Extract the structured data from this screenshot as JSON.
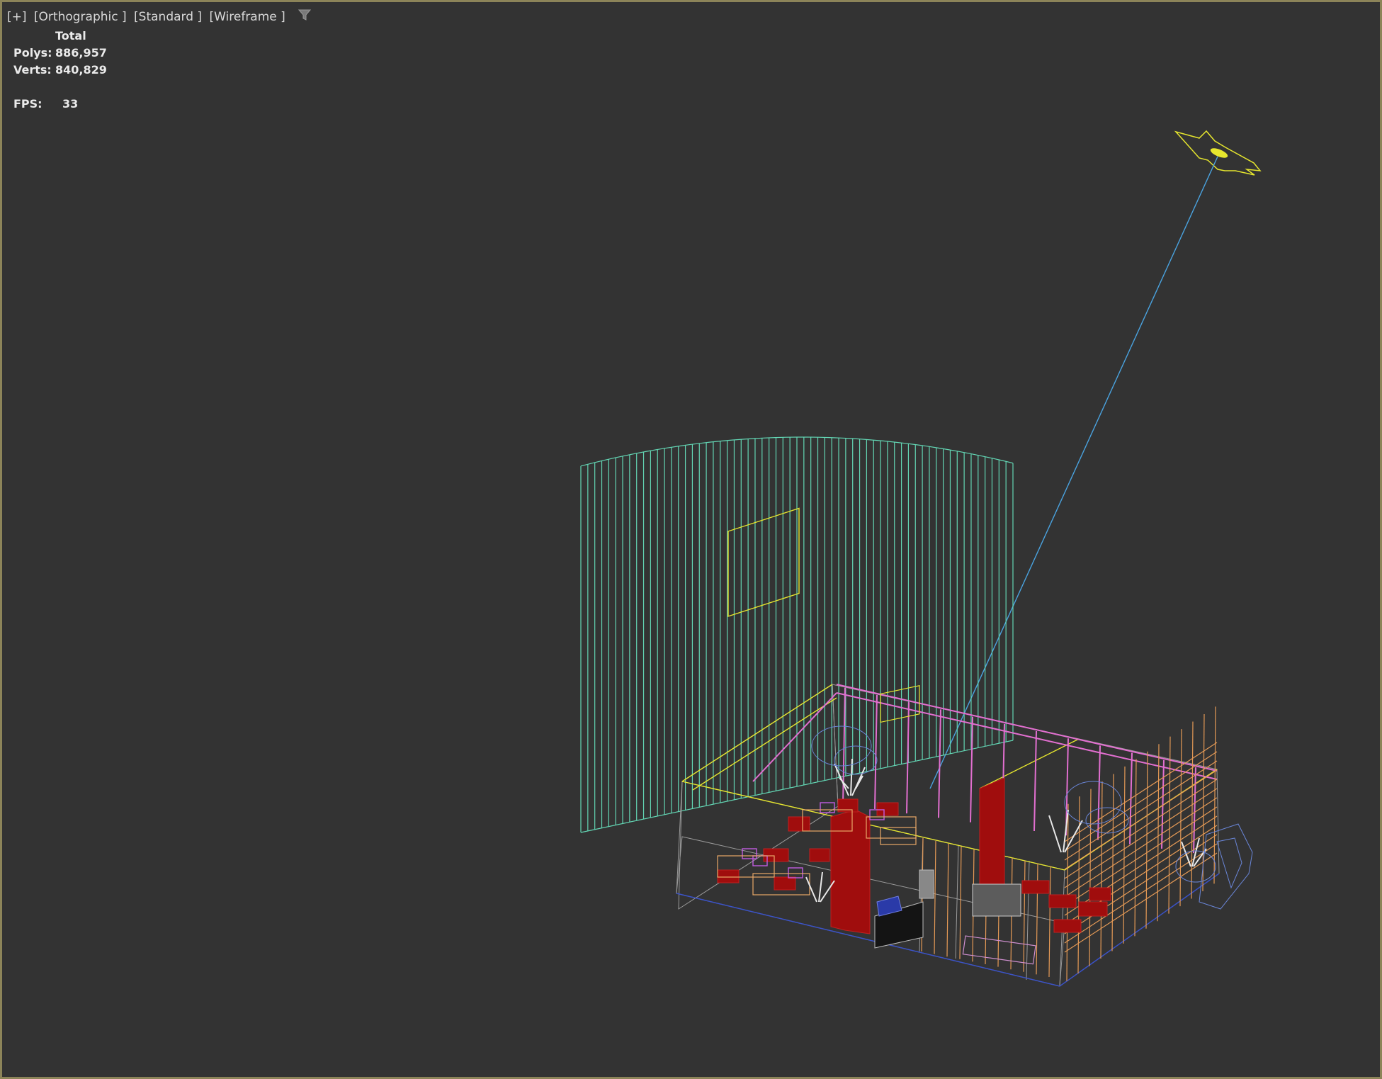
{
  "viewport": {
    "labels": [
      "[+]",
      "[Orthographic ]",
      "[Standard ]",
      "[Wireframe ]"
    ],
    "filter_icon": "funnel-icon"
  },
  "stats": {
    "header": "Total",
    "polys_label": "Polys:",
    "polys_value": "886,957",
    "verts_label": "Verts:",
    "verts_value": "840,829",
    "fps_label": "FPS:",
    "fps_value": "33"
  },
  "colors": {
    "background": "#333333",
    "border": "#8c8459",
    "text": "#eaeaea",
    "light": "#e6e62e",
    "light_line": "#4aa3e0",
    "curtain": "#63d6b4",
    "pink": "#e26fd0",
    "orange": "#e59a56",
    "red": "#a00d0d",
    "grey_wire": "#9a9a9a"
  }
}
